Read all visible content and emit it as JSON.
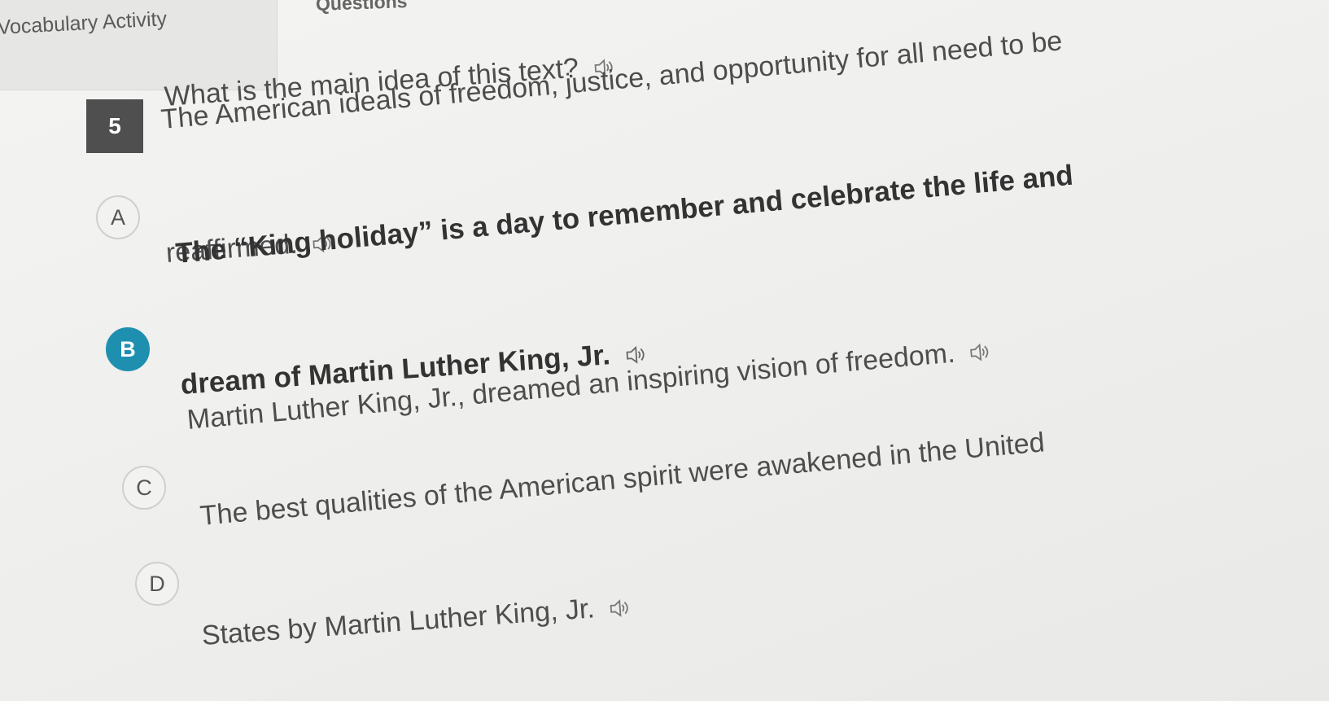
{
  "tabs": {
    "vocabulary_activity": "Vocabulary Activity",
    "questions": "Questions"
  },
  "question": {
    "number": "5",
    "text": "What is the main idea of this text?",
    "speaker_icon": "speaker-icon"
  },
  "options": [
    {
      "letter": "A",
      "lines": [
        "The American ideals of freedom, justice, and opportunity for all need to be",
        "reaffirmed."
      ],
      "selected": false
    },
    {
      "letter": "B",
      "lines": [
        "The “King holiday” is a day to remember and celebrate the life and",
        "dream of Martin Luther King, Jr."
      ],
      "selected": true
    },
    {
      "letter": "C",
      "lines": [
        "Martin Luther King, Jr., dreamed an inspiring vision of freedom."
      ],
      "selected": false
    },
    {
      "letter": "D",
      "lines": [
        "The best qualities of the American spirit were awakened in the United",
        "States by Martin Luther King, Jr."
      ],
      "selected": false
    }
  ],
  "colors": {
    "selected": "#1f8fb0",
    "number_bg": "#4f4f4f"
  }
}
